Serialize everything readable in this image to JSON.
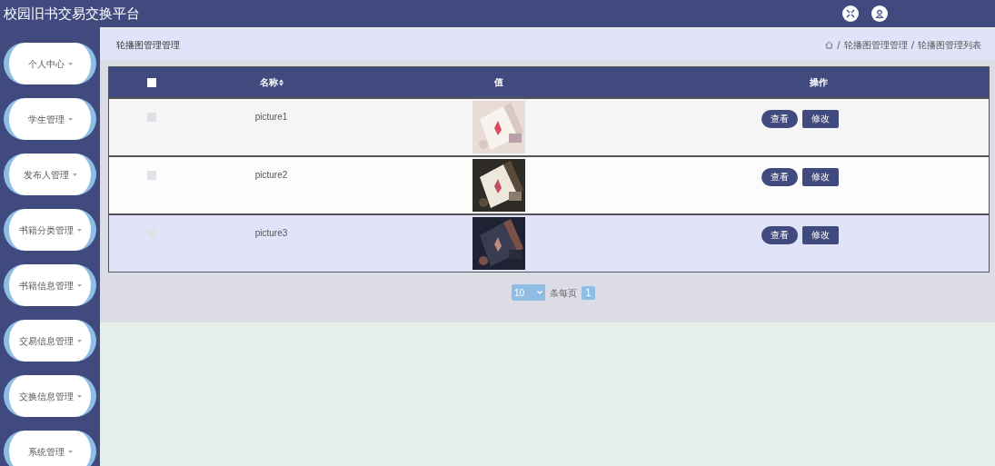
{
  "header": {
    "title": "校园旧书交易交换平台"
  },
  "sidebar": {
    "items": [
      {
        "label": "个人中心"
      },
      {
        "label": "学生管理"
      },
      {
        "label": "发布人管理"
      },
      {
        "label": "书籍分类管理"
      },
      {
        "label": "书籍信息管理"
      },
      {
        "label": "交易信息管理"
      },
      {
        "label": "交换信息管理"
      },
      {
        "label": "系统管理"
      }
    ]
  },
  "page_title": "轮播图管理管理",
  "breadcrumb": [
    {
      "separator": "/",
      "label": "轮播图管理管理"
    },
    {
      "separator": "/",
      "label": "轮播图管理列表"
    }
  ],
  "table": {
    "select_all_checked": false,
    "columns": [
      "名称",
      "值",
      "操作"
    ],
    "rows": [
      {
        "checked": false,
        "hovered": false,
        "name": "picture1",
        "value": {
          "kind": "picture"
        },
        "actions": [
          "查看",
          "修改"
        ]
      },
      {
        "checked": false,
        "hovered": false,
        "name": "picture2",
        "value": {
          "kind": "picture"
        },
        "actions": [
          "查看",
          "修改"
        ]
      },
      {
        "checked": false,
        "hovered": true,
        "name": "picture3",
        "value": {
          "kind": "picture"
        },
        "actions": [
          "查看",
          "修改"
        ]
      }
    ]
  },
  "pagination": {
    "page_size": "10",
    "page_size_label": "条每页",
    "pages": [
      {
        "label": "1",
        "selected": true
      }
    ]
  }
}
